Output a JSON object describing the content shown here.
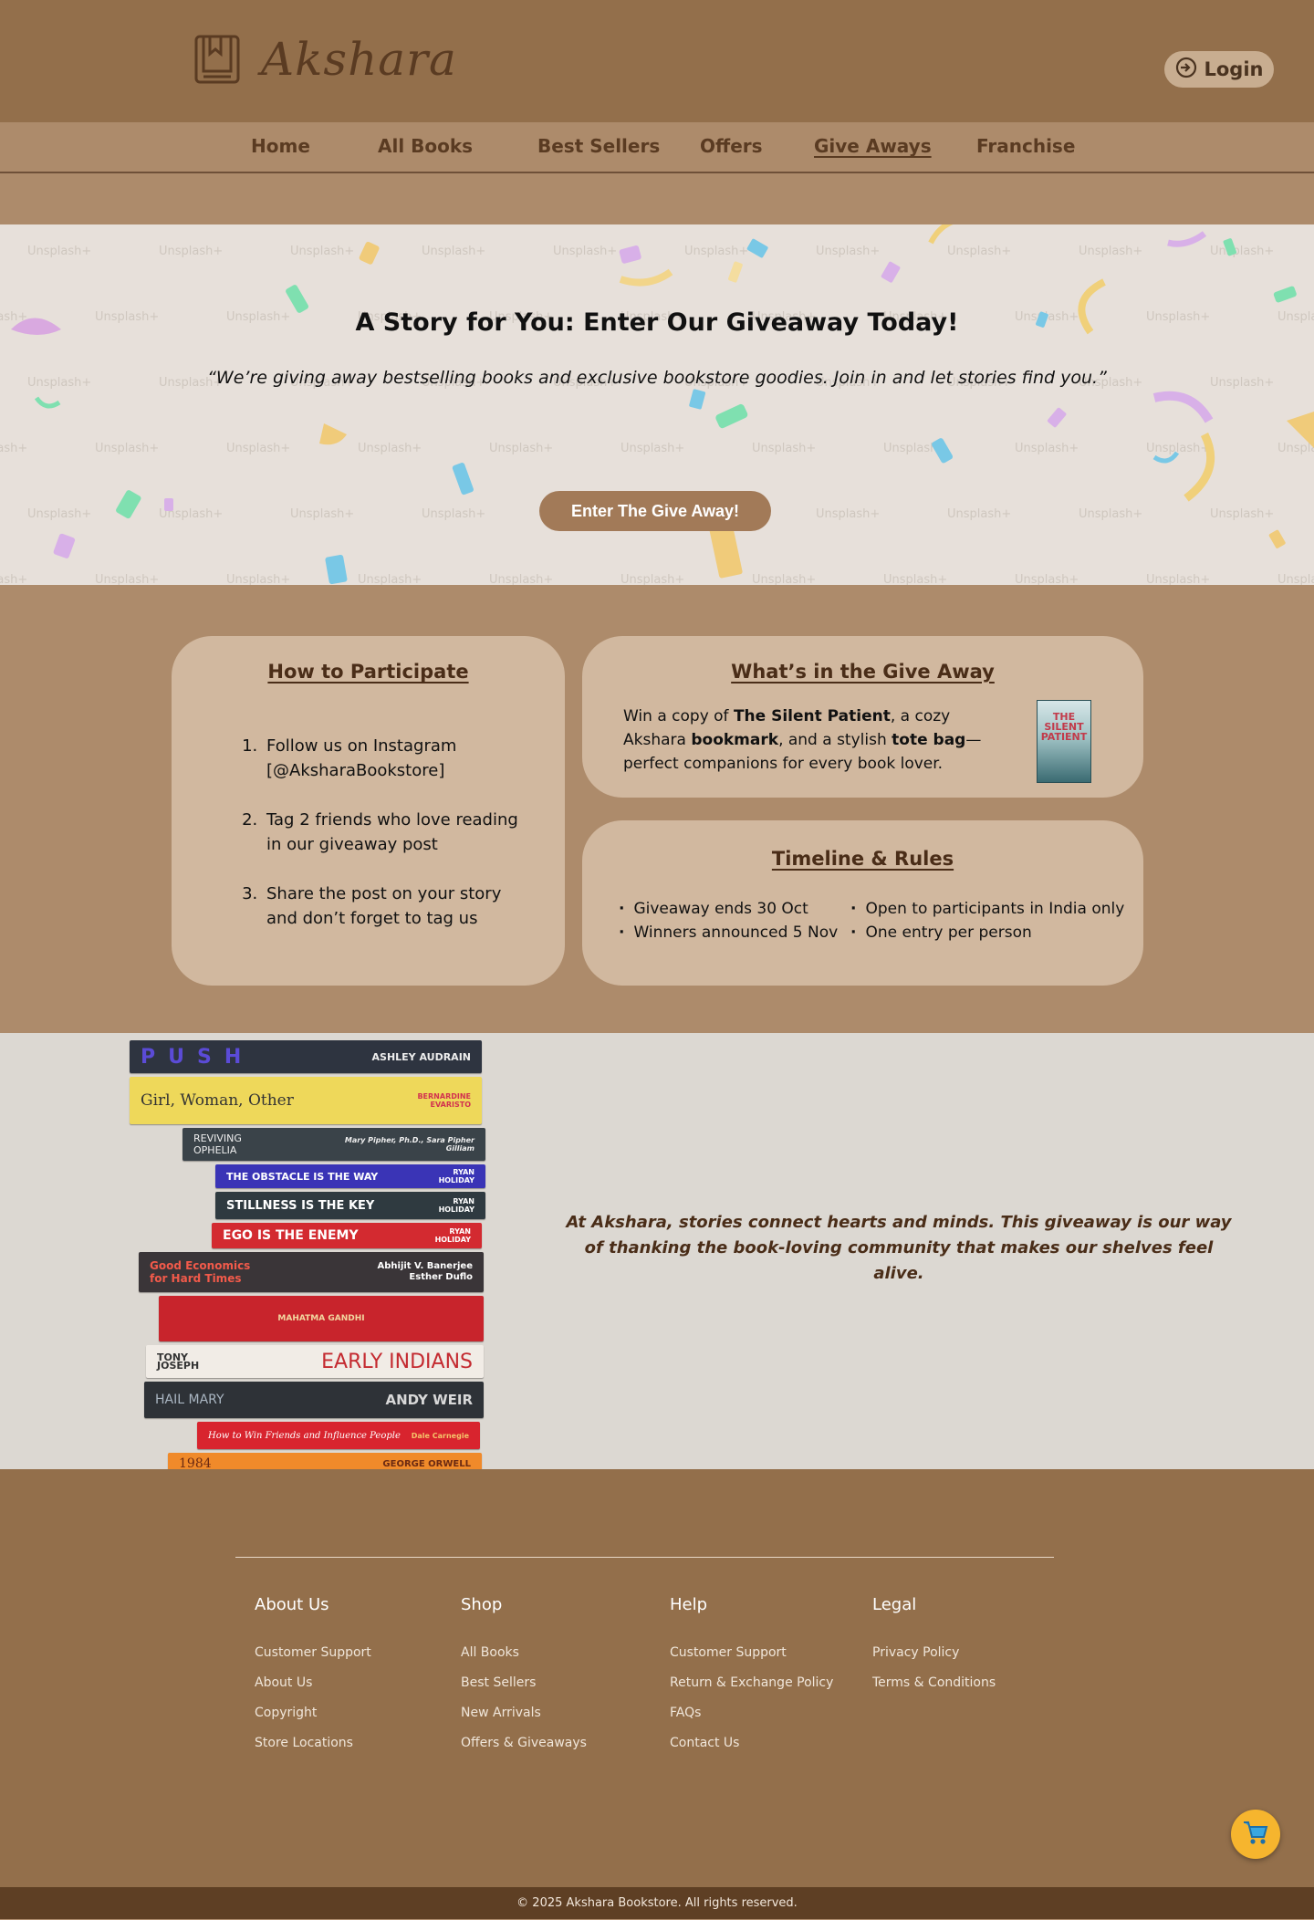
{
  "header": {
    "brand": "Akshara",
    "login_label": "Login",
    "logo_icon": "book-icon",
    "login_icon": "login-icon"
  },
  "nav": {
    "items": [
      {
        "label": "Home"
      },
      {
        "label": "All Books"
      },
      {
        "label": "Best Sellers"
      },
      {
        "label": "Offers"
      },
      {
        "label": "Give Aways",
        "active": true
      },
      {
        "label": "Franchise"
      }
    ]
  },
  "hero": {
    "title": "A Story for You: Enter Our Giveaway Today!",
    "quote": "“We’re giving away bestselling books and exclusive bookstore goodies. Join in and let stories find you.”",
    "cta_label": "Enter The Give Away!",
    "watermark": "Unsplash+"
  },
  "participate": {
    "title": "How to Participate",
    "steps": [
      "Follow us on Instagram [@AksharaBookstore]",
      "Tag 2 friends who love reading in our giveaway post",
      "Share the post on your story and don’t forget to tag us"
    ]
  },
  "whats_in": {
    "title": "What’s in the Give Away",
    "text_1": "Win a copy of ",
    "bold_1": "The Silent Patient",
    "text_2": ", a cozy Akshara ",
    "bold_2": "bookmark",
    "text_3": ", and a stylish ",
    "bold_3": "tote bag",
    "text_4": "—perfect companions for every book lover.",
    "book_cover_line1": "THE",
    "book_cover_line2": "SILENT",
    "book_cover_line3": "PATIENT"
  },
  "rules": {
    "title": "Timeline & Rules",
    "left": [
      "Giveaway ends 30 Oct",
      "Winners announced 5 Nov"
    ],
    "right": [
      "Open to participants in India only",
      "One entry per person"
    ]
  },
  "story": {
    "text": "At Akshara, stories connect hearts and minds. This giveaway is our way of thanking the book-loving community that makes our shelves feel alive.",
    "books": [
      {
        "title": "PUSH",
        "author": "ASHLEY AUDRAIN"
      },
      {
        "title": "Girl, Woman, Other",
        "author": "BERNARDINE EVARISTO"
      },
      {
        "title": "REVIVING OPHELIA",
        "author": "Mary Pipher, Ph.D., Sara Pipher Gilliam"
      },
      {
        "title": "THE OBSTACLE IS THE WAY",
        "author": "RYAN HOLIDAY"
      },
      {
        "title": "STILLNESS IS THE KEY",
        "author": "RYAN HOLIDAY"
      },
      {
        "title": "EGO IS THE ENEMY",
        "author": "RYAN HOLIDAY"
      },
      {
        "title": "Good Economics for Hard Times",
        "author": "Abhijit V. Banerjee Esther Duflo"
      },
      {
        "title": "MAHATMA GANDHI",
        "author": ""
      },
      {
        "title": "EARLY INDIANS",
        "author": "TONY JOSEPH"
      },
      {
        "title": "HAIL MARY",
        "author": "ANDY WEIR"
      },
      {
        "title": "How to Win Friends and Influence People",
        "author": "Dale Carnegie"
      },
      {
        "title": "1984",
        "author": "GEORGE ORWELL"
      }
    ]
  },
  "footer": {
    "columns": [
      {
        "title": "About Us",
        "links": [
          "Customer Support",
          "About Us",
          "Copyright",
          "Store Locations"
        ]
      },
      {
        "title": "Shop",
        "links": [
          "All Books",
          "Best Sellers",
          "New Arrivals",
          "Offers & Giveaways"
        ]
      },
      {
        "title": "Help",
        "links": [
          "Customer Support",
          "Return & Exchange Policy",
          "FAQs",
          "Contact Us"
        ]
      },
      {
        "title": "Legal",
        "links": [
          "Privacy Policy",
          "Terms & Conditions"
        ]
      }
    ],
    "copyright": "© 2025 Akshara Bookstore. All rights reserved.",
    "cart_icon": "cart-icon"
  },
  "colors": {
    "header_bg": "#936f4b",
    "page_bg": "#ad8b6b",
    "card_bg": "#d1b89f",
    "cta_bg": "#a27a58",
    "heading_brown": "#4a2d18",
    "footer_bottom": "#5e3f24",
    "cart_yellow": "#f6b52e"
  }
}
